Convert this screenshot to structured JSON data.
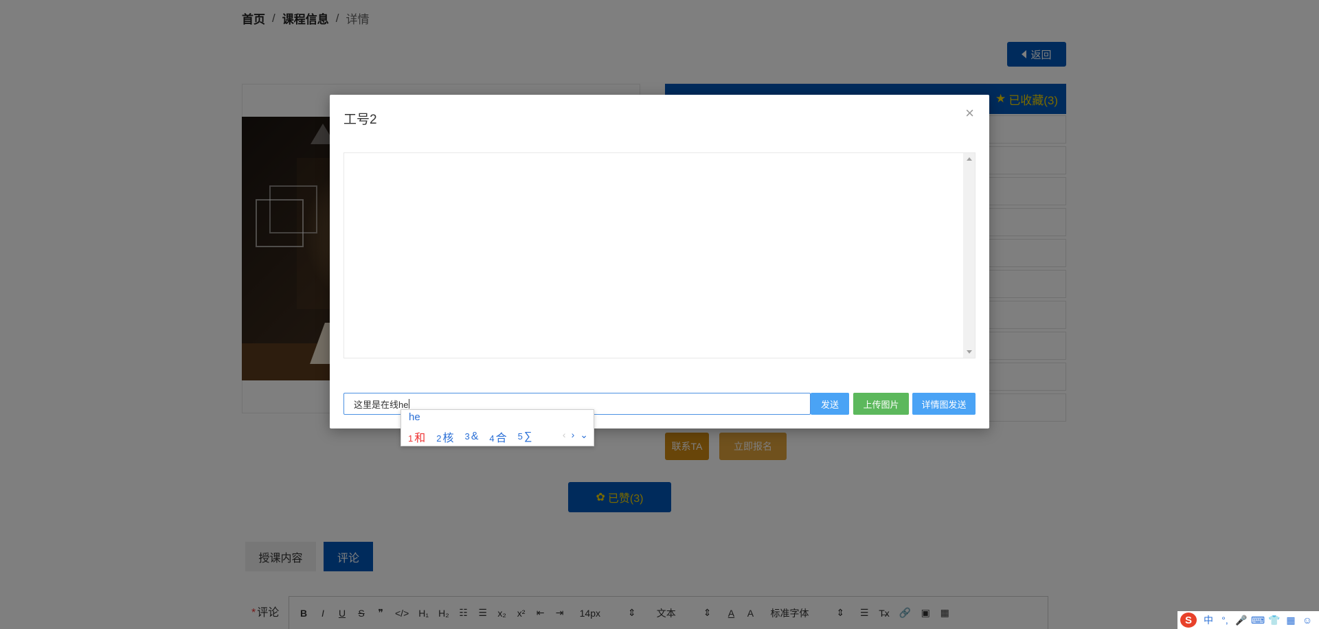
{
  "breadcrumb": {
    "home": "首页",
    "course_info": "课程信息",
    "current": "详情",
    "separator": "/"
  },
  "back_button": {
    "label": "返回"
  },
  "course_panel": {
    "favorite_label": "已收藏(3)",
    "row_count": 10
  },
  "actions": {
    "contact_label": "联系TA",
    "enroll_label": "立即报名",
    "like_label": "已赞(3)"
  },
  "tabs": [
    {
      "label": "授课内容",
      "active": false
    },
    {
      "label": "评论",
      "active": true
    }
  ],
  "comment": {
    "required_mark": "*",
    "label": "评论"
  },
  "editor_toolbar": {
    "bold": "B",
    "italic": "I",
    "underline": "U",
    "strike": "S",
    "quote": "❞",
    "code": "</>",
    "h1": "H₁",
    "h2": "H₂",
    "ordered_list": "☷",
    "bullet_list": "☰",
    "subscript": "x₂",
    "superscript": "x²",
    "outdent": "⇤",
    "indent": "⇥",
    "font_size": "14px",
    "block_type": "文本",
    "font_color": "A",
    "background_color": "A",
    "font_family": "标准字体",
    "align": "☰",
    "clear_format": "T̶x",
    "link": "🔗",
    "image": "▣",
    "video": "▦",
    "select_arrow": "⇕"
  },
  "modal": {
    "title": "工号2",
    "close": "×",
    "input_value": "这里是在线he",
    "send_label": "发送",
    "upload_label": "上传图片",
    "detail_send_label": "详情图发送"
  },
  "ime_popup": {
    "composition": "he",
    "candidates": [
      {
        "num": "1",
        "text": "和"
      },
      {
        "num": "2",
        "text": "核"
      },
      {
        "num": "3",
        "text": "&"
      },
      {
        "num": "4",
        "text": "合"
      },
      {
        "num": "5",
        "text": "∑"
      }
    ],
    "prev": "‹",
    "next": "›",
    "expand": "⌄"
  },
  "ime_status_bar": {
    "logo": "S",
    "mode": "中",
    "punct": "°,",
    "mic": "🎤",
    "keyboard": "⌨",
    "skin": "👕",
    "toolbox": "▦",
    "extra": "☺"
  },
  "colors": {
    "primary_blue": "#0057b8",
    "gold_text": "#f5d400",
    "orange": "#d08a12",
    "send_blue": "#4aa3f5",
    "upload_green": "#5cb85c"
  }
}
